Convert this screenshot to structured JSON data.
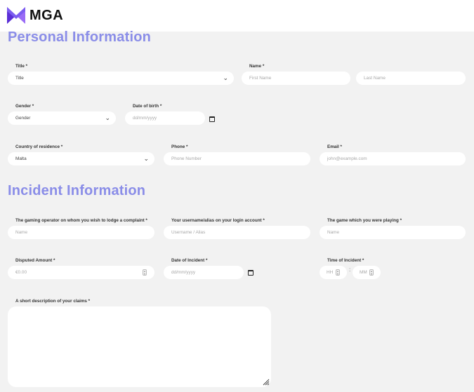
{
  "brand": {
    "name": "MGA",
    "colors": {
      "mark": "#7b5cf0",
      "heading": "#8a8de8"
    }
  },
  "personal": {
    "heading": "Personal Information",
    "title": {
      "label": "Title *",
      "value": "Title"
    },
    "name": {
      "label": "Name *",
      "first_placeholder": "First Name",
      "last_placeholder": "Last Name"
    },
    "gender": {
      "label": "Gender *",
      "value": "Gender"
    },
    "dob": {
      "label": "Date of birth *",
      "placeholder": "dd/mm/yyyy"
    },
    "country": {
      "label": "Country of residence *",
      "value": "Malta"
    },
    "phone": {
      "label": "Phone *",
      "placeholder": "Phone Number"
    },
    "email": {
      "label": "Email *",
      "placeholder": "john@example.com"
    }
  },
  "incident": {
    "heading": "Incident Information",
    "operator": {
      "label": "The gaming operator on whom you wish to lodge a complaint *",
      "placeholder": "Name"
    },
    "username": {
      "label": "Your username/alias on your login account *",
      "placeholder": "Username / Alias"
    },
    "game": {
      "label": "The game which you were playing *",
      "placeholder": "Name"
    },
    "amount": {
      "label": "Disputed Amount *",
      "placeholder": "€0.00"
    },
    "date": {
      "label": "Date of Incident *",
      "placeholder": "dd/mm/yyyy"
    },
    "time": {
      "label": "Time of Incident *",
      "hh_placeholder": "HH",
      "mm_placeholder": "MM",
      "separator": ":"
    },
    "description": {
      "label": "A short description of your claims *"
    }
  }
}
